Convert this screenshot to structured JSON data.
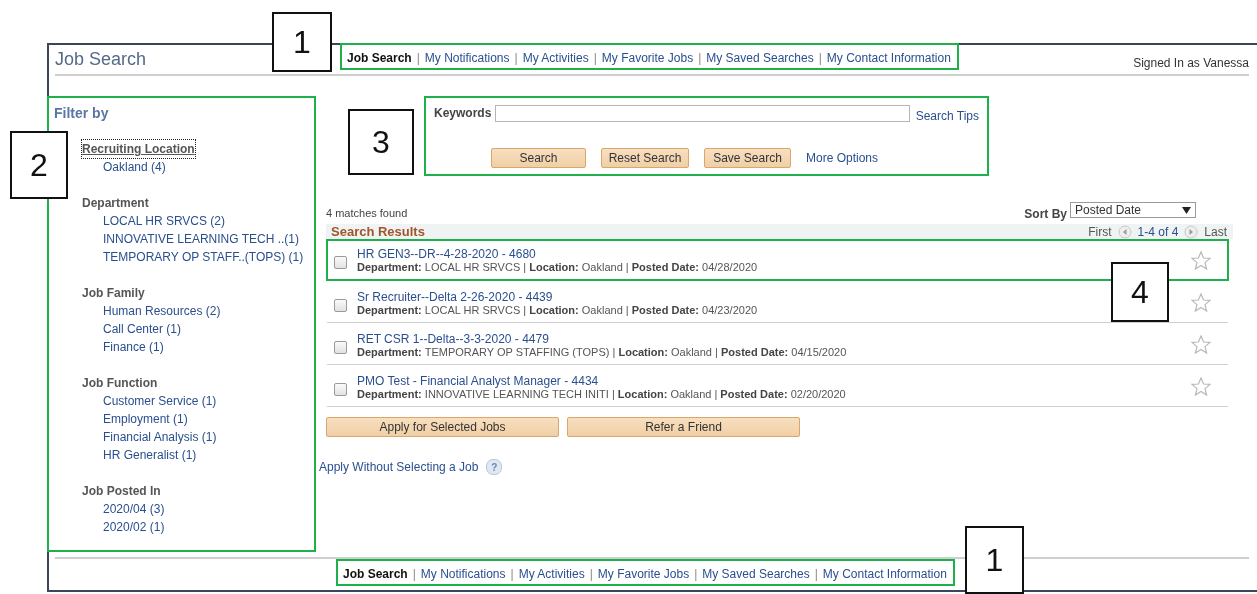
{
  "page_title": "Job Search",
  "nav_top": {
    "highlighted": true,
    "separator": "|",
    "links": [
      {
        "label": "Job Search",
        "selected": true
      },
      {
        "label": "My Notifications",
        "selected": false
      },
      {
        "label": "My Activities",
        "selected": false
      },
      {
        "label": "My Favorite Jobs",
        "selected": false
      },
      {
        "label": "My Saved Searches",
        "selected": false
      },
      {
        "label": "My Contact Information",
        "selected": false
      }
    ]
  },
  "signed_in": "Signed In as Vanessa",
  "filters": {
    "title": "Filter by",
    "highlighted": true,
    "groups": [
      {
        "heading": "Recruiting Location",
        "focused": true,
        "items": [
          "Oakland (4)"
        ]
      },
      {
        "heading": "Department",
        "focused": false,
        "items": [
          "LOCAL HR SRVCS (2)",
          "INNOVATIVE LEARNING TECH ..(1)",
          "TEMPORARY OP STAFF..(TOPS) (1)"
        ]
      },
      {
        "heading": "Job Family",
        "focused": false,
        "items": [
          "Human Resources (2)",
          "Call Center (1)",
          "Finance (1)"
        ]
      },
      {
        "heading": "Job Function",
        "focused": false,
        "items": [
          "Customer Service (1)",
          "Employment (1)",
          "Financial Analysis (1)",
          "HR Generalist (1)"
        ]
      },
      {
        "heading": "Job Posted In",
        "focused": false,
        "items": [
          "2020/04 (3)",
          "2020/02 (1)"
        ]
      }
    ]
  },
  "search": {
    "highlighted": true,
    "keywords_label": "Keywords",
    "search_tips": "Search Tips",
    "buttons": [
      "Search",
      "Reset Search",
      "Save Search"
    ],
    "more_options": "More Options"
  },
  "results": {
    "matches": "4 matches found",
    "sort_label": "Sort By",
    "sort_value": "Posted Date",
    "header": "Search Results",
    "pager": {
      "first": "First",
      "range": "1-4 of 4",
      "last": "Last"
    },
    "separator": "|",
    "rows": [
      {
        "title": "HR GEN3--DR--4-28-2020 - 4680",
        "highlighted": true,
        "checked": false,
        "favorite": false,
        "details": [
          {
            "label": "Department:",
            "value": "LOCAL HR SRVCS"
          },
          {
            "label": "Location:",
            "value": "Oakland"
          },
          {
            "label": "Posted Date:",
            "value": "04/28/2020"
          }
        ]
      },
      {
        "title": "Sr Recruiter--Delta 2-26-2020 - 4439",
        "highlighted": false,
        "checked": false,
        "favorite": false,
        "details": [
          {
            "label": "Department:",
            "value": "LOCAL HR SRVCS"
          },
          {
            "label": "Location:",
            "value": "Oakland"
          },
          {
            "label": "Posted Date:",
            "value": "04/23/2020"
          }
        ]
      },
      {
        "title": "RET CSR 1--Delta--3-3-2020 - 4479",
        "highlighted": false,
        "checked": false,
        "favorite": false,
        "details": [
          {
            "label": "Department:",
            "value": "TEMPORARY OP STAFFING (TOPS)"
          },
          {
            "label": "Location:",
            "value": "Oakland"
          },
          {
            "label": "Posted Date:",
            "value": "04/15/2020"
          }
        ]
      },
      {
        "title": "PMO Test - Financial Analyst Manager - 4434",
        "highlighted": false,
        "checked": false,
        "favorite": false,
        "details": [
          {
            "label": "Department:",
            "value": "INNOVATIVE LEARNING TECH INITI"
          },
          {
            "label": "Location:",
            "value": "Oakland"
          },
          {
            "label": "Posted Date:",
            "value": "02/20/2020"
          }
        ]
      }
    ]
  },
  "actions": {
    "buttons": [
      "Apply for Selected Jobs",
      "Refer a Friend"
    ],
    "apply_without": "Apply Without Selecting a Job",
    "help_glyph": "?"
  },
  "nav_bottom": {
    "highlighted": true,
    "separator": "|",
    "links": [
      {
        "label": "Job Search",
        "selected": true
      },
      {
        "label": "My Notifications",
        "selected": false
      },
      {
        "label": "My Activities",
        "selected": false
      },
      {
        "label": "My Favorite Jobs",
        "selected": false
      },
      {
        "label": "My Saved Searches",
        "selected": false
      },
      {
        "label": "My Contact Information",
        "selected": false
      }
    ]
  },
  "callouts": [
    {
      "label": "1"
    },
    {
      "label": "2"
    },
    {
      "label": "3"
    },
    {
      "label": "4"
    },
    {
      "label": "1"
    }
  ]
}
